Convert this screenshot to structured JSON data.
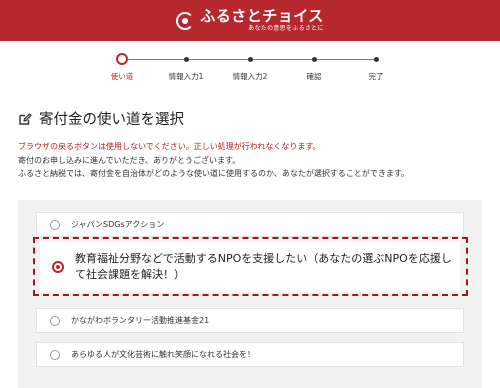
{
  "header": {
    "logo_name": "ふるさとチョイス",
    "logo_tagline": "あなたの意思をふるさとに",
    "background_color": "#b7282e"
  },
  "stepper": {
    "steps": [
      {
        "label": "使い道",
        "state": "current"
      },
      {
        "label": "情報入力1",
        "state": "upcoming"
      },
      {
        "label": "情報入力2",
        "state": "upcoming"
      },
      {
        "label": "確認",
        "state": "upcoming"
      },
      {
        "label": "完了",
        "state": "upcoming"
      }
    ]
  },
  "page": {
    "title": "寄付金の使い道を選択",
    "title_icon": "edit-icon",
    "warning": "ブラウザの戻るボタンは使用しないでください。正しい処理が行われなくなります。",
    "intro_line1": "寄付のお申し込みに進んでいただき、ありがとうございます。",
    "intro_line2": "ふるさと納税では、寄付金を自治体がどのような使い道に使用するのか、あなたが選択することができます。"
  },
  "options": [
    {
      "label": "ジャパンSDGsアクション",
      "selected": false
    },
    {
      "label": "教育福祉分野などで活動するNPOを支援したい（あなたの選ぶNPOを応援して社会課題を解決！）",
      "selected": true
    },
    {
      "label": "かながわボランタリー活動推進基金21",
      "selected": false
    },
    {
      "label": "あらゆる人が文化芸術に触れ笑顔になれる社会を！",
      "selected": false
    }
  ],
  "colors": {
    "accent": "#b7282e",
    "warning_text": "#c4161c",
    "panel_bg": "#f2f2f2"
  }
}
